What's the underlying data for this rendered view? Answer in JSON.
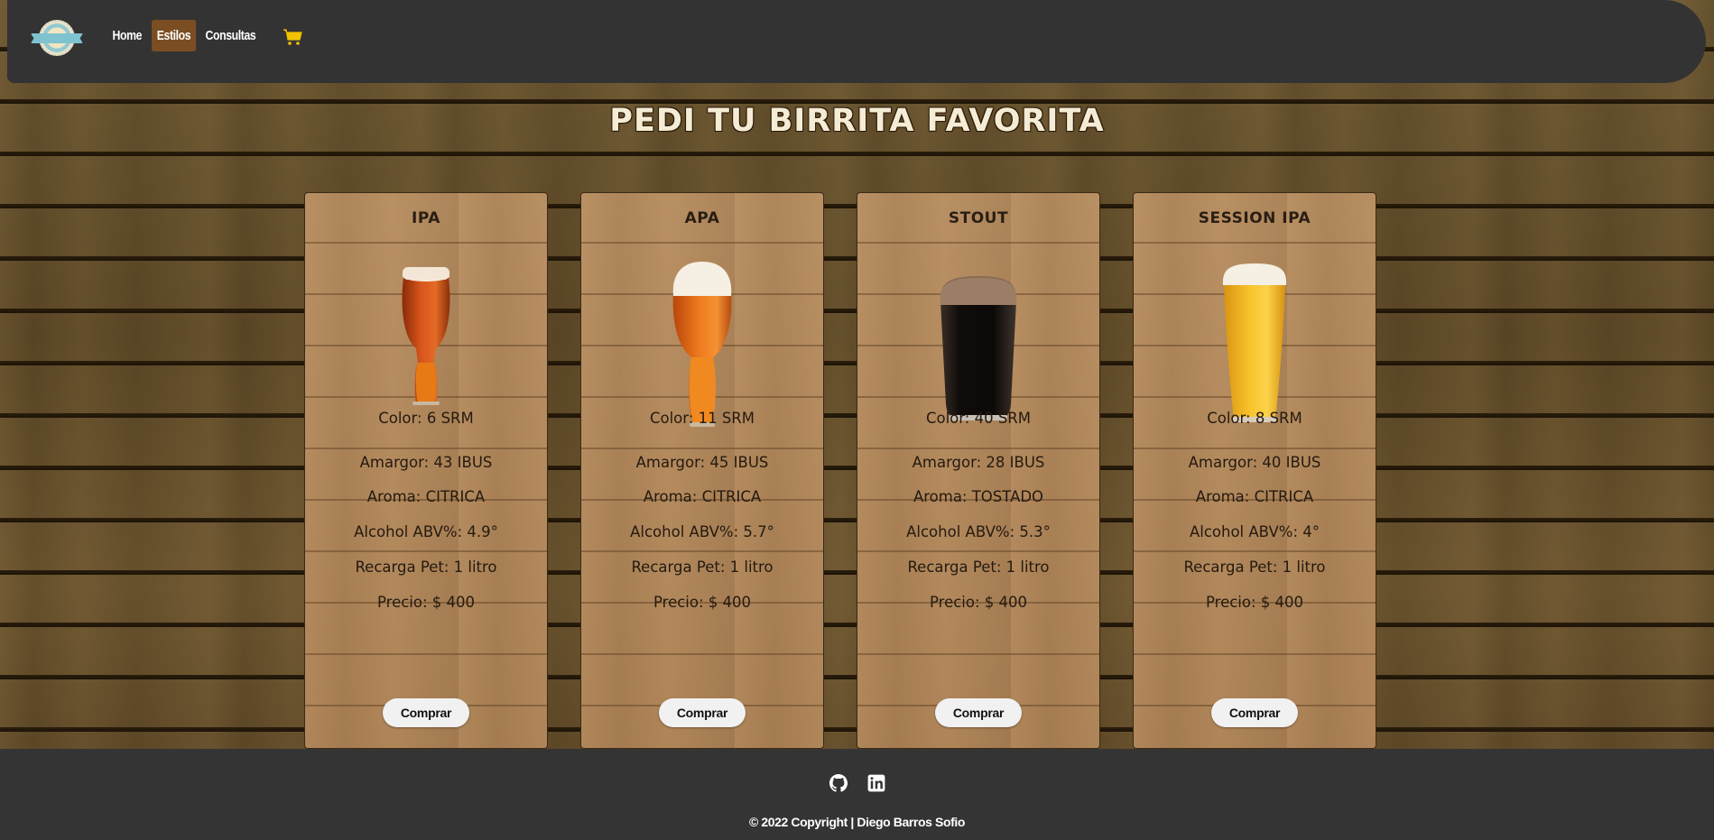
{
  "nav": {
    "links": [
      {
        "label": "Home"
      },
      {
        "label": "Estilos"
      },
      {
        "label": "Consultas"
      }
    ],
    "cart_icon": "cart-icon",
    "logo_icon": "brewery-logo-icon"
  },
  "page_title": "PEDI TU BIRRITA FAVORITA",
  "beers": [
    {
      "name": "IPA",
      "glass_icon": "ipa-glass-image",
      "color_label": "Color: 6 SRM",
      "bitterness_label": "Amargor: 43 IBUS",
      "aroma_label": "Aroma: CITRICA",
      "alcohol_label": "Alcohol ABV%: 4.9°",
      "refill_label": "Recarga Pet: 1 litro",
      "price_label": "Precio: $ 400",
      "buy_label": "Comprar",
      "beer_color": "#d0501a"
    },
    {
      "name": "APA",
      "glass_icon": "apa-glass-image",
      "color_label": "Color: 11 SRM",
      "bitterness_label": "Amargor: 45 IBUS",
      "aroma_label": "Aroma: CITRICA",
      "alcohol_label": "Alcohol ABV%: 5.7°",
      "refill_label": "Recarga Pet: 1 litro",
      "price_label": "Precio: $ 400",
      "buy_label": "Comprar",
      "beer_color": "#e86a15"
    },
    {
      "name": "STOUT",
      "glass_icon": "stout-glass-image",
      "color_label": "Color: 40 SRM",
      "bitterness_label": "Amargor: 28 IBUS",
      "aroma_label": "Aroma: TOSTADO",
      "alcohol_label": "Alcohol ABV%: 5.3°",
      "refill_label": "Recarga Pet: 1 litro",
      "price_label": "Precio: $ 400",
      "buy_label": "Comprar",
      "beer_color": "#161210"
    },
    {
      "name": "SESSION IPA",
      "glass_icon": "session-ipa-glass-image",
      "color_label": "Color: 8 SRM",
      "bitterness_label": "Amargor: 40 IBUS",
      "aroma_label": "Aroma: CITRICA",
      "alcohol_label": "Alcohol ABV%: 4°",
      "refill_label": "Recarga Pet: 1 litro",
      "price_label": "Precio: $ 400",
      "buy_label": "Comprar",
      "beer_color": "#f0b521"
    }
  ],
  "footer": {
    "icons": [
      "github-icon",
      "linkedin-icon"
    ],
    "copyright": "© 2022 Copyright  |  Diego Barros Sofio"
  },
  "colors": {
    "navbar_bg": "#333333",
    "active_nav_bg": "#7a4e22",
    "footer_bg": "#343434",
    "card_bg": "#b08558",
    "button_bg": "#f1f1f1"
  }
}
